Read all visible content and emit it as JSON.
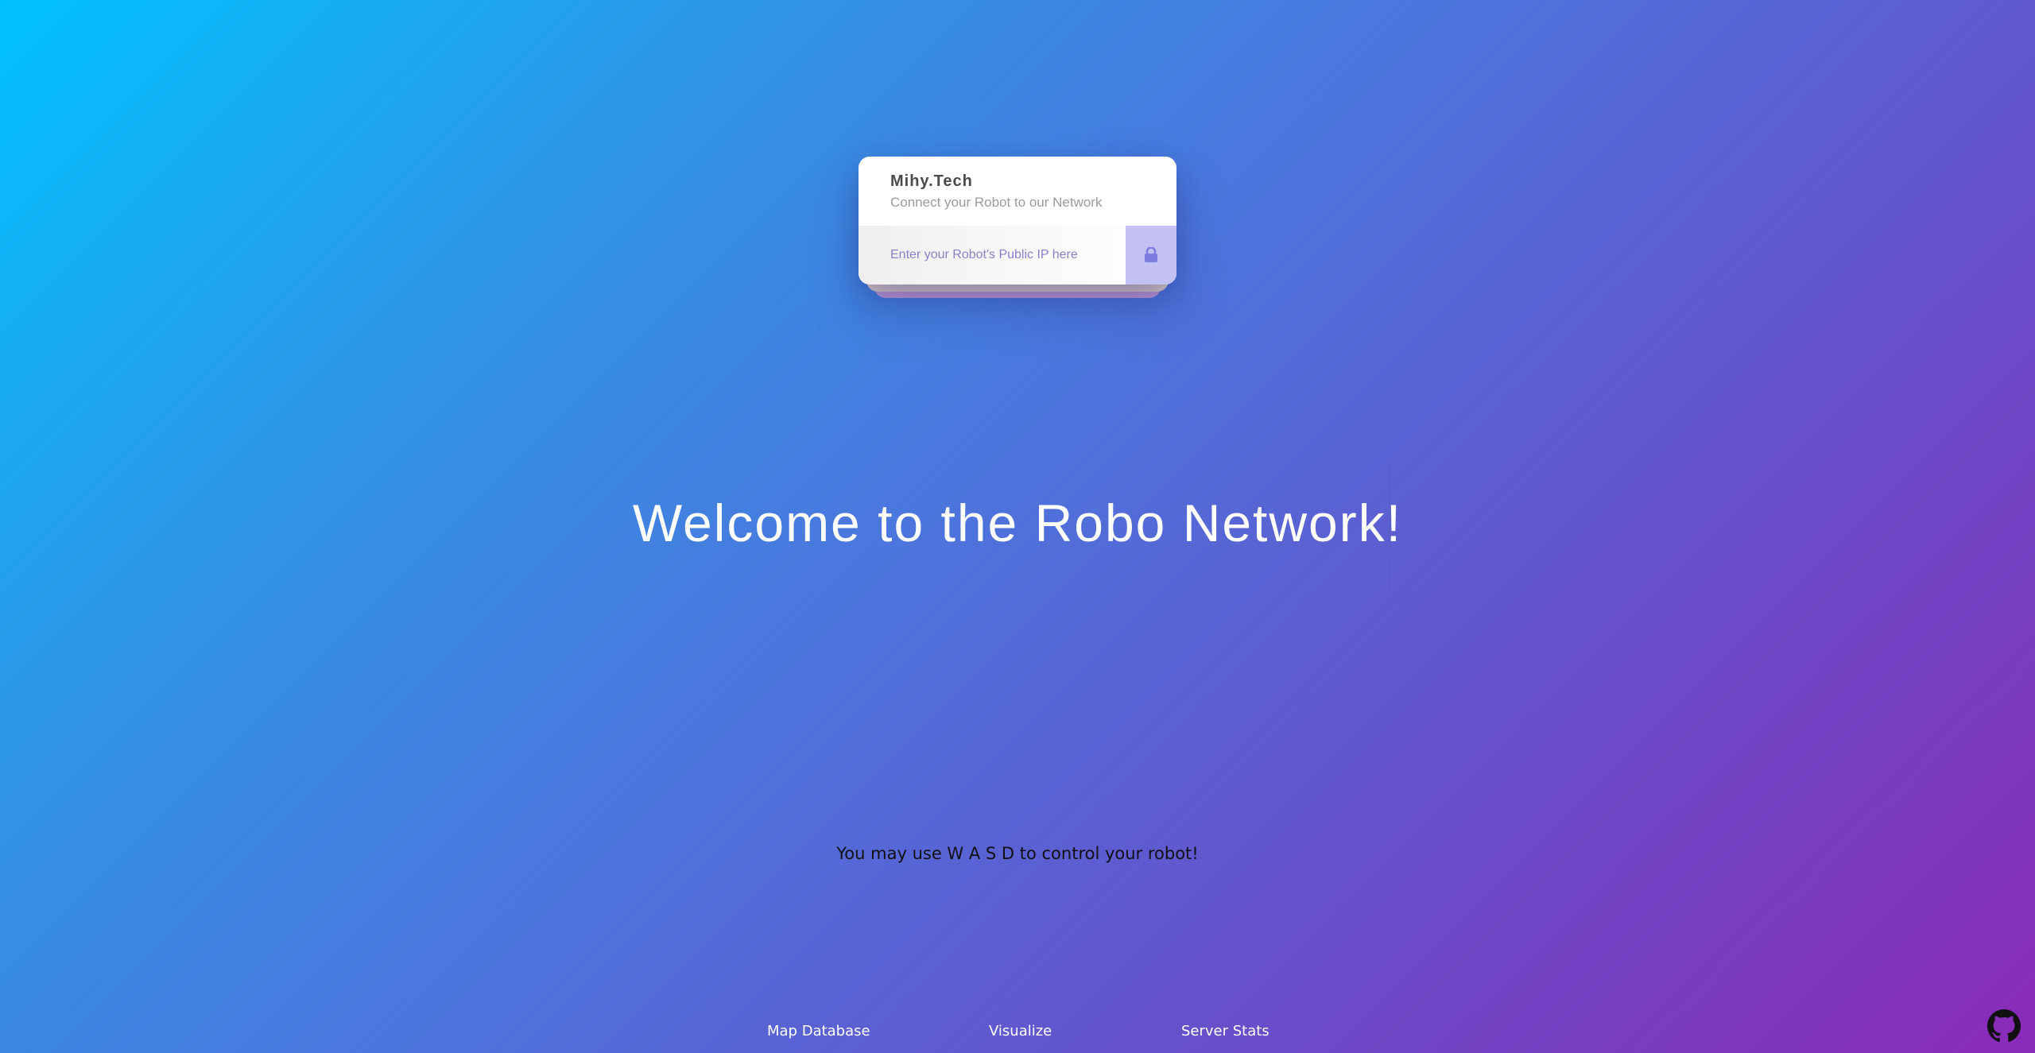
{
  "card": {
    "brand": "Mihy.Tech",
    "tagline": "Connect your Robot to our Network",
    "ip_placeholder": "Enter your Robot's Public IP here",
    "ip_value": "",
    "submit_icon": "lock-icon"
  },
  "headline": "Welcome to the Robo Network!",
  "hint": "You may use W A S D to control your robot!",
  "footer": {
    "links": [
      "Map Database",
      "Visualize",
      "Server Stats"
    ],
    "github_icon": "github-icon"
  },
  "colors": {
    "gradient_start": "#00c2ff",
    "gradient_end": "#8a2ab8",
    "lock_button": "#c3c1f4",
    "placeholder": "#8683c9"
  }
}
